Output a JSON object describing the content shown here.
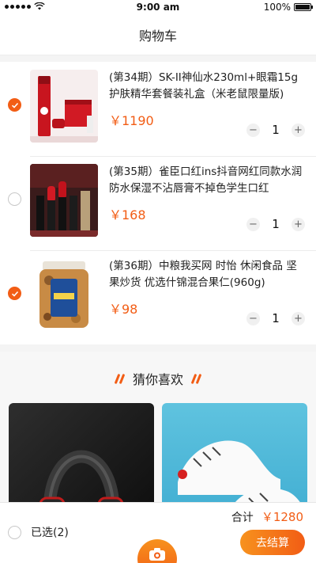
{
  "status_bar": {
    "time": "9:00 am",
    "battery": "100%"
  },
  "nav": {
    "title": "购物车"
  },
  "cart": {
    "items": [
      {
        "title": "(第34期）SK-II神仙水230ml+眼霜15g护肤精华套餐装礼盒（米老鼠限量版)",
        "price": "￥1190",
        "qty": "1",
        "checked": true
      },
      {
        "title": "(第35期）雀臣口红ins抖音网红同款水润防水保湿不沾唇膏不掉色学生口红",
        "price": "￥168",
        "qty": "1",
        "checked": false
      },
      {
        "title": "(第36期）中粮我买网 时怡 休闲食品 坚果炒货 优选什锦混合果仁(960g)",
        "price": "￥98",
        "qty": "1",
        "checked": true
      }
    ],
    "minus": "−",
    "plus": "+"
  },
  "guess": {
    "title": "猜你喜欢"
  },
  "bottom": {
    "selected_label": "已选(2)",
    "total_label": "合计",
    "total_amount": "￥1280",
    "checkout_label": "去结算"
  },
  "colors": {
    "accent": "#f25d15",
    "accent_light": "#f7921e"
  },
  "icons": [
    "wifi-icon",
    "battery-icon",
    "check-icon",
    "camera-icon"
  ]
}
